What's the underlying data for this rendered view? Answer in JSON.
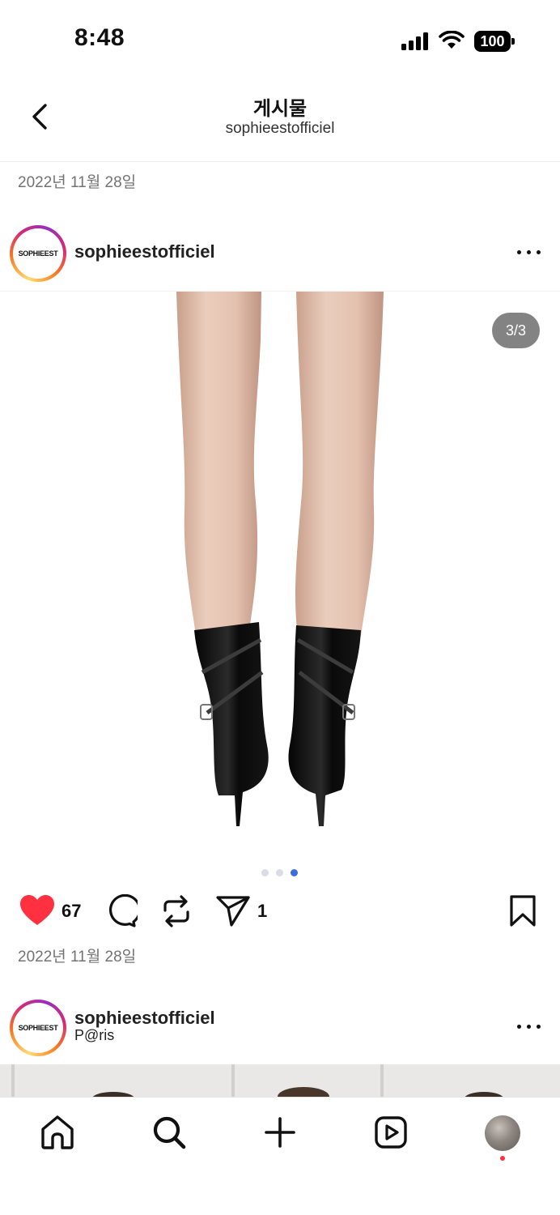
{
  "status_bar": {
    "time": "8:48",
    "battery": "100"
  },
  "header": {
    "title": "게시물",
    "subtitle": "sophieestofficiel"
  },
  "posts": [
    {
      "date": "2022년 11월 28일",
      "avatar_text": "SOPHIEEST",
      "username": "sophieestofficiel",
      "media_counter": "3/3",
      "carousel_active_index": 3,
      "carousel_total": 3,
      "likes": "67",
      "shares": "1"
    },
    {
      "date": "2022년 11월 28일",
      "avatar_text": "SOPHIEEST",
      "username": "sophieestofficiel",
      "location": "P@ris"
    }
  ],
  "colors": {
    "like_red": "#ff3040",
    "active_dot": "#3f6be0",
    "secondary_text": "#737373"
  },
  "icons": {
    "back": "chevron-left-icon",
    "more": "more-horizontal-icon",
    "like": "heart-filled-icon",
    "comment": "comment-bubble-icon",
    "repost": "repost-icon",
    "share": "send-icon",
    "save": "bookmark-icon",
    "home": "home-icon",
    "search": "search-icon",
    "create": "plus-icon",
    "reels": "reels-icon"
  }
}
